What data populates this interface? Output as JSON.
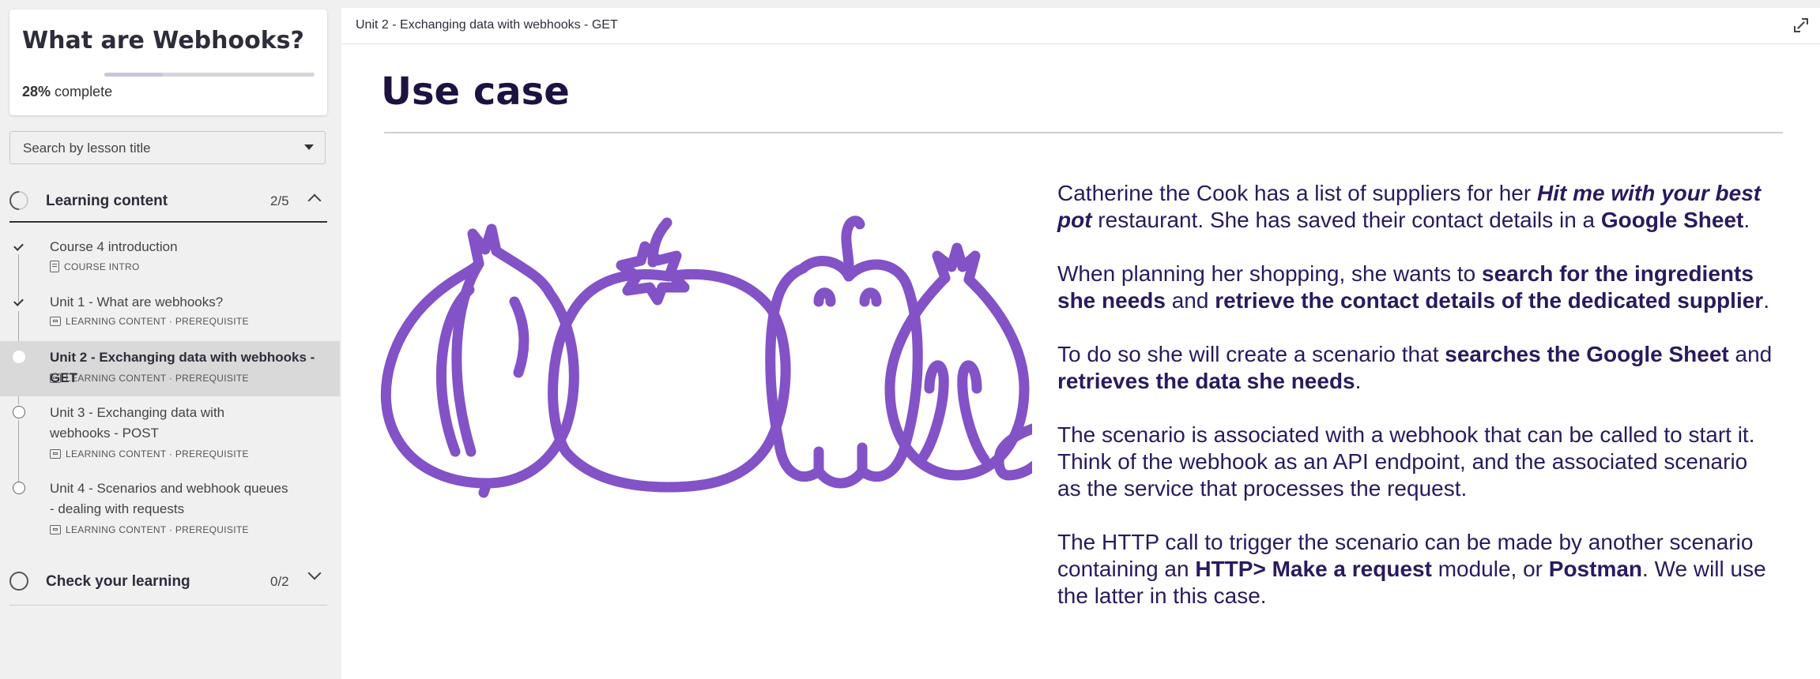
{
  "course": {
    "title": "What are Webhooks?",
    "progress_percent": 28,
    "progress_value": "28%",
    "progress_suffix": "complete"
  },
  "search": {
    "placeholder": "Search by lesson title"
  },
  "sections": [
    {
      "label": "Learning content",
      "count": "2/5",
      "expanded": true,
      "lessons": [
        {
          "title": "Course 4 introduction",
          "meta": "COURSE INTRO",
          "status": "complete"
        },
        {
          "title": "Unit 1 - What are webhooks?",
          "meta": "LEARNING CONTENT · PREREQUISITE",
          "status": "complete"
        },
        {
          "title": "Unit 2 - Exchanging data with webhooks - GET",
          "meta": "LEARNING CONTENT · PREREQUISITE",
          "status": "current"
        },
        {
          "title": "Unit 3 - Exchanging data with webhooks - POST",
          "meta": "LEARNING CONTENT · PREREQUISITE",
          "status": "open"
        },
        {
          "title": "Unit 4 - Scenarios and webhook queues - dealing with requests",
          "meta": "LEARNING CONTENT · PREREQUISITE",
          "status": "open"
        }
      ]
    },
    {
      "label": "Check your learning",
      "count": "0/2",
      "expanded": false
    }
  ],
  "main": {
    "breadcrumb": "Unit 2 - Exchanging data with webhooks - GET",
    "page_title": "Use case",
    "paragraphs": {
      "p1": {
        "a": "Catherine the Cook has a list of suppliers for her ",
        "b": "Hit me with your best pot",
        "c": " restaurant. She has saved their contact details in a ",
        "d": "Google Sheet",
        "e": "."
      },
      "p2": {
        "a": "When planning her shopping, she wants to ",
        "b": "search for the ingredients she needs",
        "c": " and ",
        "d": "retrieve the contact details of the dedicated supplier",
        "e": "."
      },
      "p3": {
        "a": "To do so she will create a scenario that ",
        "b": "searches the Google Sheet",
        "c": " and ",
        "d": "retrieves the data she needs",
        "e": "."
      },
      "p4": {
        "a": "The scenario is associated with a webhook that can be called to start it. Think of the webhook as an API endpoint, and the associated scenario as the service that processes the request."
      },
      "p5": {
        "a": "The HTTP call to trigger the scenario can be made by another scenario containing an ",
        "b": "HTTP> Make a request",
        "c": " module, or ",
        "d": "Postman",
        "e": ". We will use the latter in this case."
      }
    }
  },
  "colors": {
    "accent_purple": "#8352c6",
    "title_navy": "#1e1240",
    "body_text": "#2a1a5e"
  },
  "icons": {
    "expand": "expand-icon",
    "illustration": "vegetables-illustration"
  }
}
